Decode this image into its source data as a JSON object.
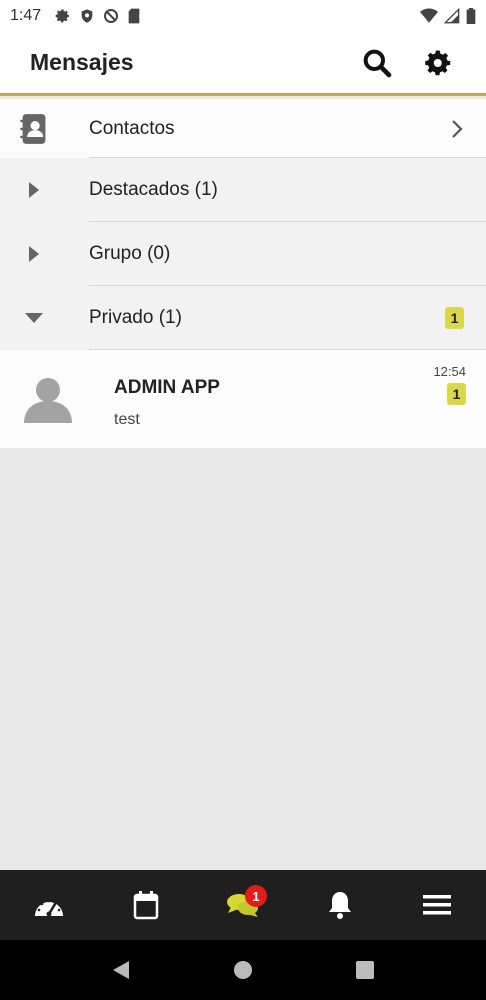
{
  "status_bar": {
    "time": "1:47"
  },
  "header": {
    "title": "Mensajes"
  },
  "list": {
    "contacts_label": "Contactos",
    "groups": [
      {
        "label": "Destacados (1)",
        "expanded": false
      },
      {
        "label": "Grupo (0)",
        "expanded": false
      },
      {
        "label": "Privado (1)",
        "expanded": true,
        "badge": "1"
      }
    ]
  },
  "chat": {
    "name": "ADMIN APP",
    "preview": "test",
    "time": "12:54",
    "badge": "1"
  },
  "bottom_nav": {
    "messages_badge": "1"
  },
  "colors": {
    "accent": "#c8a84e",
    "badge": "#d8d84a",
    "active_nav": "#d4d832",
    "notif": "#e21b1b"
  }
}
